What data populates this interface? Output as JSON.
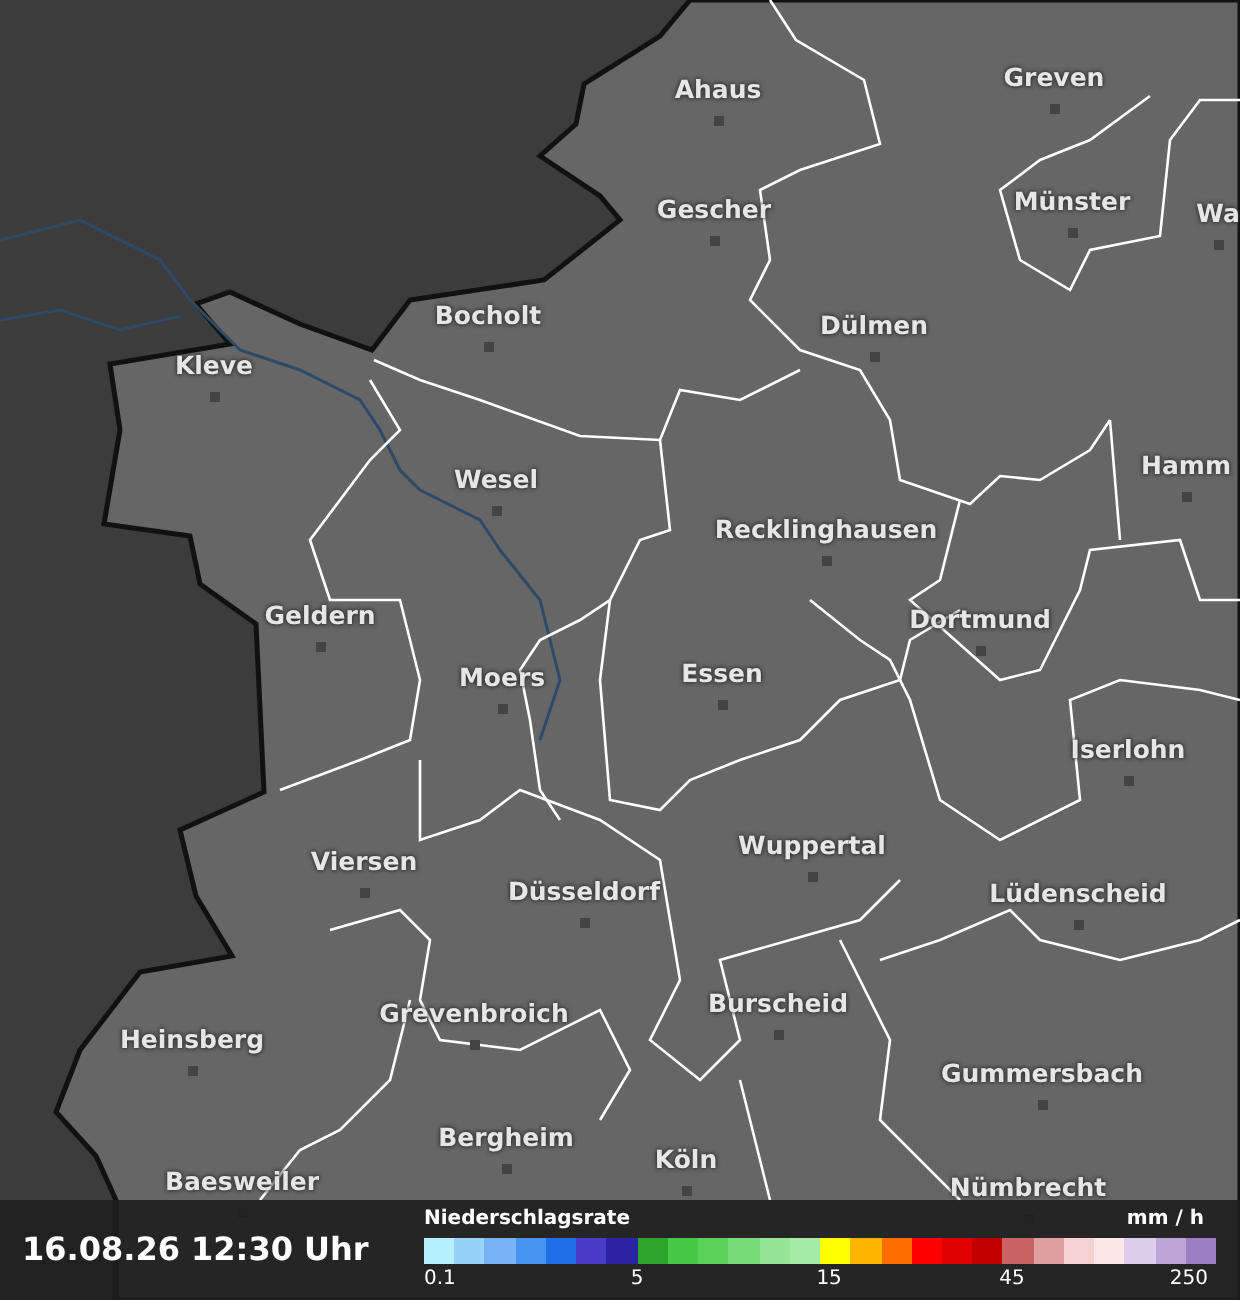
{
  "map": {
    "cities": [
      {
        "name": "Ahaus"
      },
      {
        "name": "Greven"
      },
      {
        "name": "Gescher"
      },
      {
        "name": "Münster"
      },
      {
        "name": "Wa"
      },
      {
        "name": "Bocholt"
      },
      {
        "name": "Dülmen"
      },
      {
        "name": "Kleve"
      },
      {
        "name": "Wesel"
      },
      {
        "name": "Hamm"
      },
      {
        "name": "Recklinghausen"
      },
      {
        "name": "Geldern"
      },
      {
        "name": "Dortmund"
      },
      {
        "name": "Moers"
      },
      {
        "name": "Essen"
      },
      {
        "name": "Iserlohn"
      },
      {
        "name": "Viersen"
      },
      {
        "name": "Wuppertal"
      },
      {
        "name": "Düsseldorf"
      },
      {
        "name": "Lüdenscheid"
      },
      {
        "name": "Heinsberg"
      },
      {
        "name": "Grevenbroich"
      },
      {
        "name": "Burscheid"
      },
      {
        "name": "Gummersbach"
      },
      {
        "name": "Baesweiler"
      },
      {
        "name": "Bergheim"
      },
      {
        "name": "Köln"
      },
      {
        "name": "Nümbrecht"
      }
    ]
  },
  "footer": {
    "timestamp": "16.08.26 12:30 Uhr",
    "legend": {
      "title": "Niederschlagsrate",
      "unit": "mm / h",
      "colors": [
        {
          "color": "#b4f0ff"
        },
        {
          "color": "#96d2fa"
        },
        {
          "color": "#78b4f5"
        },
        {
          "color": "#4696f0"
        },
        {
          "color": "#1e6ee6"
        },
        {
          "color": "#4a3cc8"
        },
        {
          "color": "#2d23a5"
        },
        {
          "color": "#2da52d"
        },
        {
          "color": "#46c846"
        },
        {
          "color": "#5ad25a"
        },
        {
          "color": "#78dc78"
        },
        {
          "color": "#96e696"
        },
        {
          "color": "#a5eba5"
        },
        {
          "color": "#ffff00"
        },
        {
          "color": "#ffb400"
        },
        {
          "color": "#ff6e00"
        },
        {
          "color": "#ff0000"
        },
        {
          "color": "#e10000"
        },
        {
          "color": "#c30000"
        },
        {
          "color": "#c86464"
        },
        {
          "color": "#e1a0a0"
        },
        {
          "color": "#f5d2d2"
        },
        {
          "color": "#fde6e6"
        },
        {
          "color": "#dccdeb"
        },
        {
          "color": "#bea5d7"
        },
        {
          "color": "#9b7dc3"
        }
      ],
      "ticks": [
        "0.1",
        "5",
        "15",
        "45",
        "250"
      ]
    }
  }
}
